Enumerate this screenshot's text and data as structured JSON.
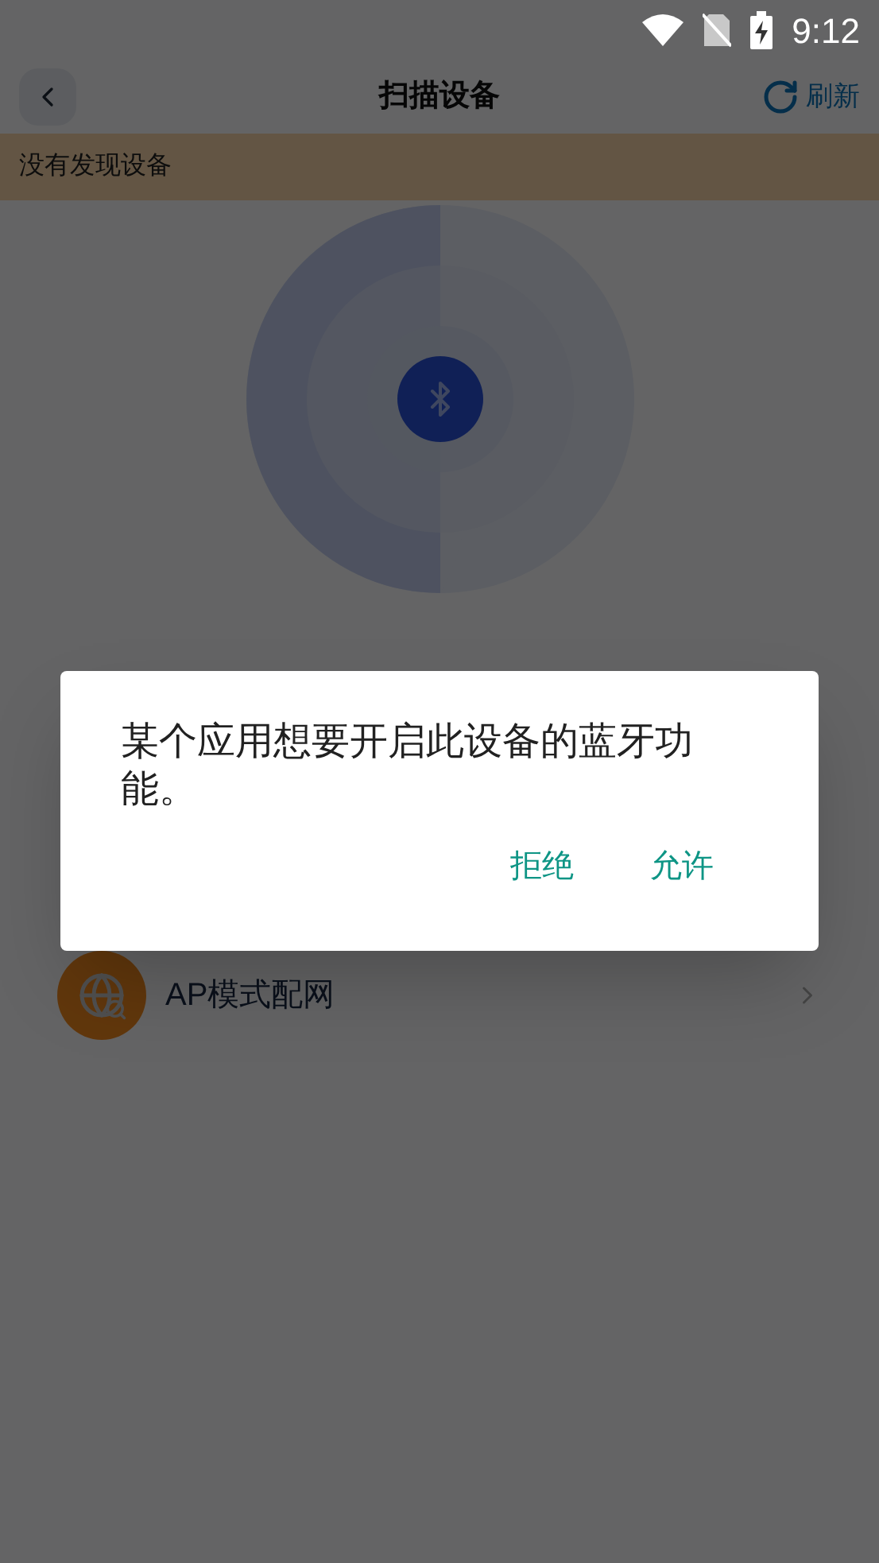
{
  "status_bar": {
    "time": "9:12"
  },
  "header": {
    "title": "扫描设备",
    "refresh": "刷新"
  },
  "notice": "没有发现设备",
  "options": [
    {
      "label": "AP模式配网"
    }
  ],
  "dialog": {
    "message": "某个应用想要开启此设备的蓝牙功能。",
    "buttons": [
      "拒绝",
      "允许"
    ]
  }
}
